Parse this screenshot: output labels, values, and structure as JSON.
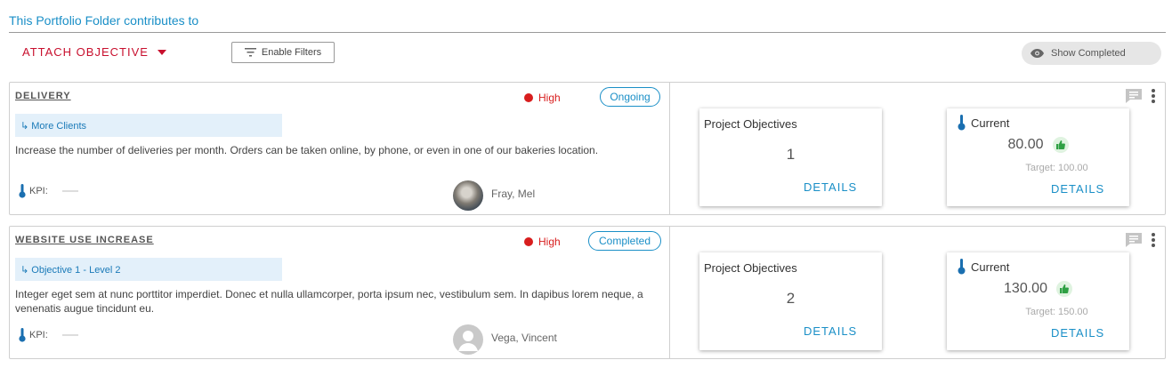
{
  "header": {
    "title": "This Portfolio Folder contributes to",
    "attach_label": "ATTACH OBJECTIVE",
    "filters_label": "Enable Filters",
    "show_completed_label": "Show Completed"
  },
  "colors": {
    "accent": "#1a8fc7",
    "brand_red": "#c8102e",
    "priority_high": "#d81e1e",
    "thumb_green": "#2ea043"
  },
  "objectives": [
    {
      "title": "DELIVERY",
      "priority": "High",
      "status": "Ongoing",
      "parent": "↳ More Clients",
      "description": "Increase the number of deliveries per month. Orders can be taken online, by phone, or even in one of our bakeries location.",
      "kpi_label": "KPI:",
      "owner": "Fray, Mel",
      "avatar": "photo",
      "project_objectives_label": "Project Objectives",
      "project_objectives_count": "1",
      "details_label": "DETAILS",
      "current_label": "Current",
      "current_value": "80.00",
      "target": "Target: 100.00"
    },
    {
      "title": "WEBSITE USE INCREASE",
      "priority": "High",
      "status": "Completed",
      "parent": "↳ Objective 1 - Level 2",
      "description": "Integer eget sem at nunc porttitor imperdiet. Donec et nulla ullamcorper, porta ipsum nec, vestibulum sem. In dapibus lorem neque, a venenatis augue tincidunt eu.",
      "kpi_label": "KPI:",
      "owner": "Vega, Vincent",
      "avatar": "generic-user-icon",
      "project_objectives_label": "Project Objectives",
      "project_objectives_count": "2",
      "details_label": "DETAILS",
      "current_label": "Current",
      "current_value": "130.00",
      "target": "Target: 150.00"
    }
  ]
}
